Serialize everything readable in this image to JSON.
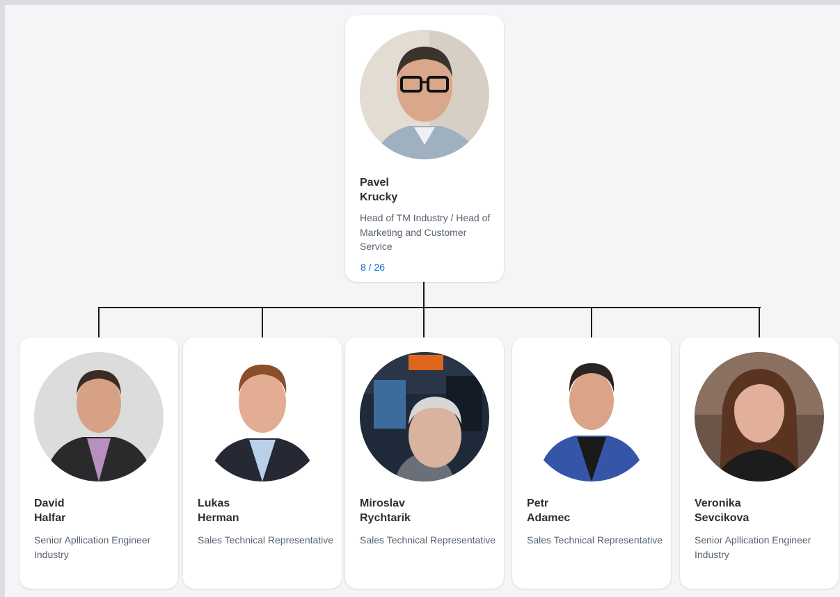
{
  "manager": {
    "first_name": "Pavel",
    "last_name": "Krucky",
    "title": "Head of TM Industry / Head of Marketing and Customer Service",
    "count": "8 / 26"
  },
  "reports": [
    {
      "first_name": "David",
      "last_name": "Halfar",
      "title": "Senior Apllication Engineer Industry"
    },
    {
      "first_name": "Lukas",
      "last_name": "Herman",
      "title": "Sales Technical Representative"
    },
    {
      "first_name": "Miroslav",
      "last_name": "Rychtarik",
      "title": "Sales Technical Representative"
    },
    {
      "first_name": "Petr",
      "last_name": "Adamec",
      "title": "Sales Technical Representative"
    },
    {
      "first_name": "Veronika",
      "last_name": "Sevcikova",
      "title": "Senior Apllication Engineer Industry"
    }
  ],
  "colors": {
    "canvas": "#f4f5f7",
    "card": "#ffffff",
    "name_text": "#2b2f33",
    "title_text": "#556270",
    "count_link": "#0a6ed1",
    "connector": "#1a1a1a"
  }
}
